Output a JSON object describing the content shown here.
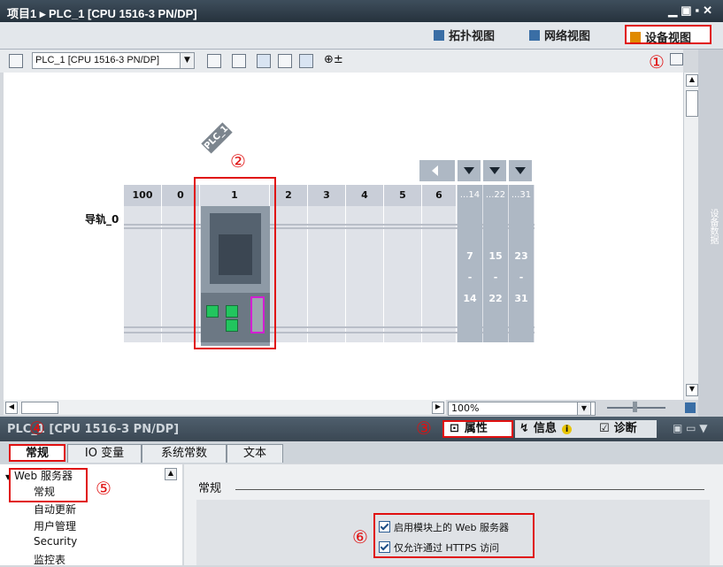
{
  "window": {
    "title": "项目1 ▸ PLC_1 [CPU 1516-3 PN/DP]",
    "controls": "▁▣▪✕"
  },
  "views": {
    "topology": "拓扑视图",
    "network": "网络视图",
    "device": "设备视图"
  },
  "toolbar": {
    "device_select": "PLC_1 [CPU 1516-3 PN/DP]",
    "zoom_symbol": "⊕±"
  },
  "rack": {
    "rail_label": "导轨_0",
    "plc_tag": "PLC_1",
    "slots": [
      "100",
      "0",
      "1",
      "2",
      "3",
      "4",
      "5",
      "6"
    ],
    "groups": [
      {
        "head": "...14",
        "top": "7",
        "mid": "-",
        "bottom": "14"
      },
      {
        "head": "...22",
        "top": "15",
        "mid": "-",
        "bottom": "22"
      },
      {
        "head": "...31",
        "top": "23",
        "mid": "-",
        "bottom": "31"
      }
    ]
  },
  "zoom": "100%",
  "side_tab": "设备数据",
  "panel": {
    "title": "PLC_1 [CPU 1516-3 PN/DP]",
    "prop_tabs": {
      "properties": "属性",
      "info": "信息",
      "diagnostics": "诊断"
    },
    "tabs": [
      "常规",
      "IO 变量",
      "系统常数",
      "文本"
    ],
    "tree": {
      "parent": "Web 服务器",
      "items": [
        "常规",
        "自动更新",
        "用户管理",
        "Security",
        "监控表"
      ]
    },
    "section_title": "常规",
    "options": [
      "启用模块上的 Web 服务器",
      "仅允许通过 HTTPS 访问"
    ]
  },
  "annotations": [
    "①",
    "②",
    "③",
    "④",
    "⑤",
    "⑥"
  ],
  "colors": {
    "highlight": "#e01010",
    "titlebar": "#26323d",
    "port_green": "#22c55e",
    "port_magenta": "#d21fd2"
  }
}
